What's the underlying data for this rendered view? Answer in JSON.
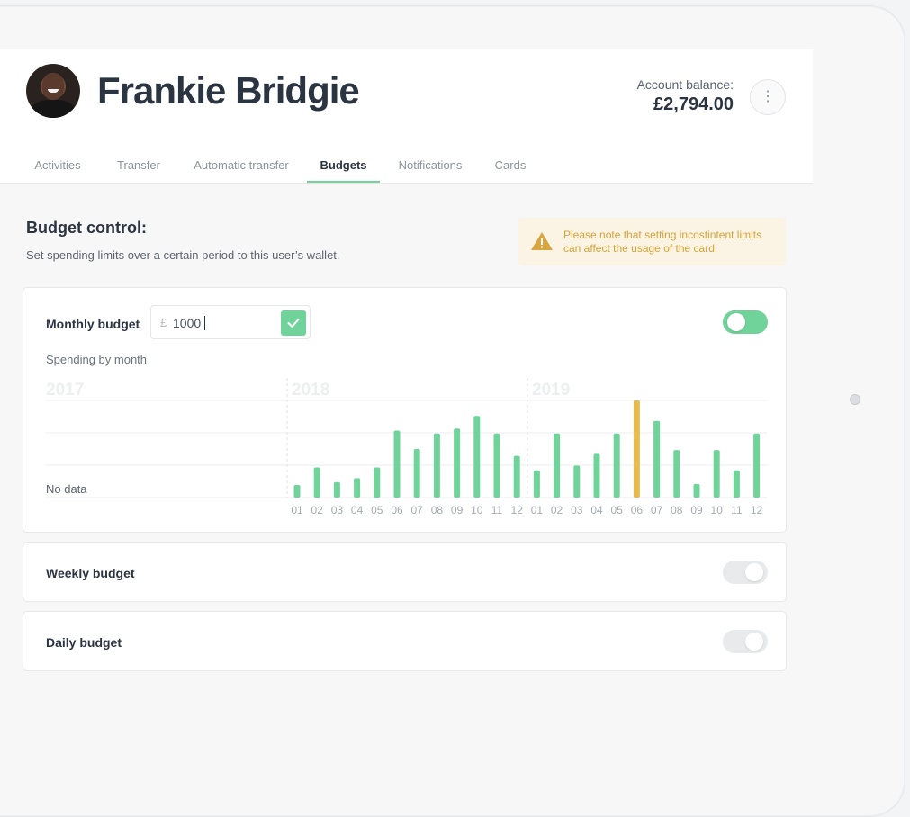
{
  "user": {
    "name": "Frankie Bridgie"
  },
  "account": {
    "balance_label": "Account balance:",
    "balance": "£2,794.00"
  },
  "menu": {
    "icon": "more-vertical-icon",
    "glyph": "⋮"
  },
  "tabs": [
    {
      "label": "Activities",
      "active": false
    },
    {
      "label": "Transfer",
      "active": false
    },
    {
      "label": "Automatic transfer",
      "active": false
    },
    {
      "label": "Budgets",
      "active": true
    },
    {
      "label": "Notifications",
      "active": false
    },
    {
      "label": "Cards",
      "active": false
    }
  ],
  "budget_control": {
    "title": "Budget control:",
    "description": "Set spending limits over a certain period to this user’s wallet.",
    "warning": "Please note that setting incostintent limits can affect the usage of the card."
  },
  "monthly_budget": {
    "label": "Monthly budget",
    "currency_symbol": "£",
    "amount": "1000",
    "enabled": true,
    "chart_caption": "Spending by month"
  },
  "weekly_budget": {
    "label": "Weekly budget",
    "enabled": false
  },
  "daily_budget": {
    "label": "Daily budget",
    "enabled": false
  },
  "colors": {
    "accent": "#6fd39a",
    "highlight": "#e7bc4c",
    "warning_text": "#d4a33b",
    "warning_bg": "#fbf3e3"
  },
  "chart_data": {
    "type": "bar",
    "years": [
      "2017",
      "2018",
      "2019"
    ],
    "no_data_label": "No data",
    "categories": [
      "01",
      "02",
      "03",
      "04",
      "05",
      "06",
      "07",
      "08",
      "09",
      "10",
      "11",
      "12",
      "01",
      "02",
      "03",
      "04",
      "05",
      "06",
      "07",
      "08",
      "09",
      "10",
      "11",
      "12"
    ],
    "values": [
      13,
      31,
      16,
      20,
      31,
      69,
      50,
      66,
      71,
      84,
      66,
      43,
      28,
      66,
      33,
      45,
      66,
      100,
      79,
      49,
      14,
      49,
      28,
      66
    ],
    "highlight_index": 17,
    "ylim": [
      0,
      100
    ],
    "grid": true
  }
}
